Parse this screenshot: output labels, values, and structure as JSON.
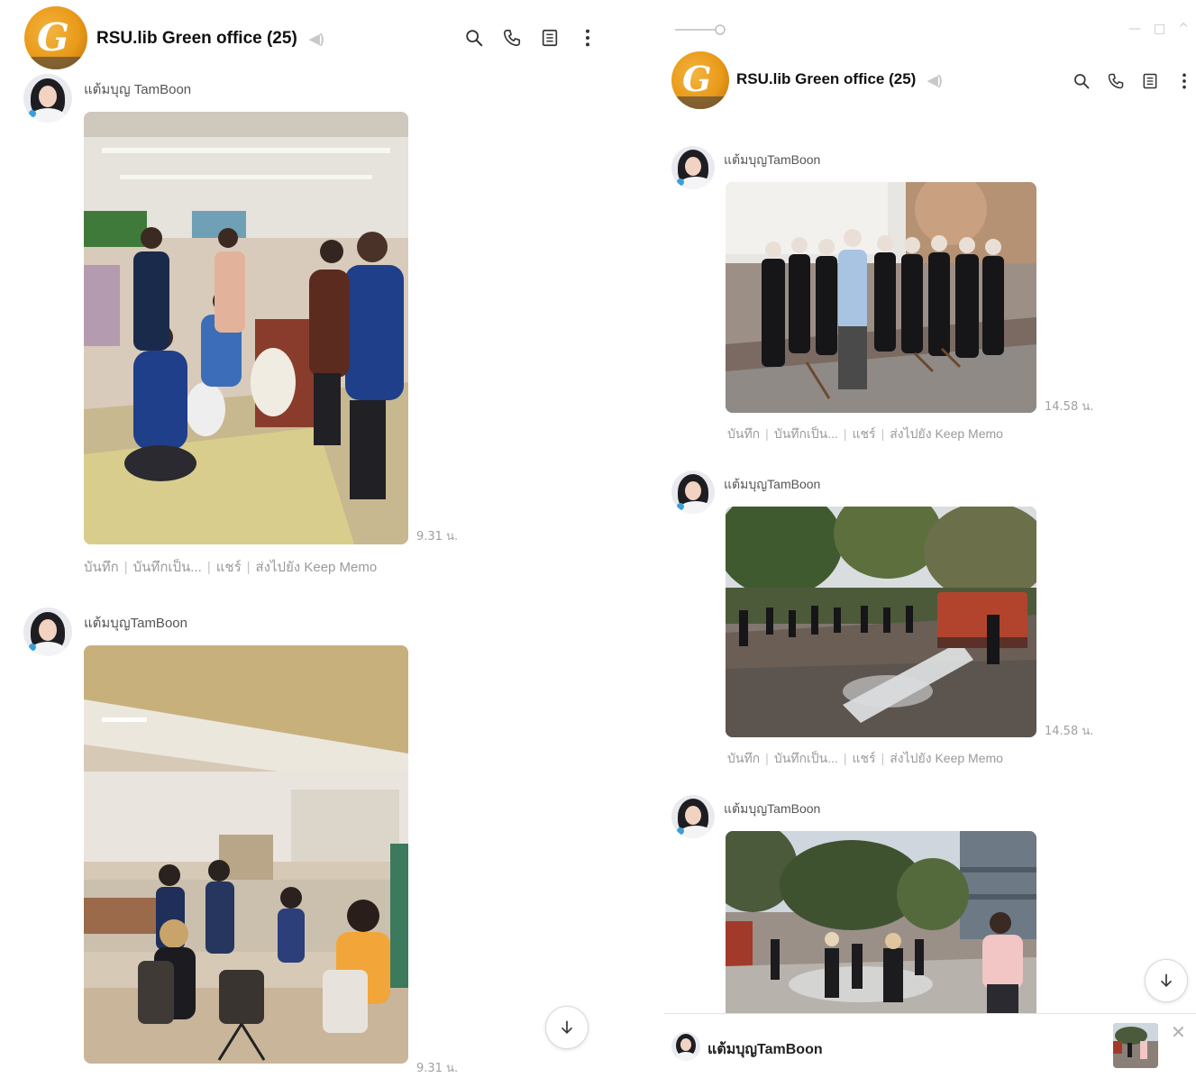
{
  "left_panel": {
    "header": {
      "group_name": "RSU.lib Green office",
      "member_count": "(25)",
      "avatar_letter": "G"
    },
    "messages": [
      {
        "sender": "แต้มบุญ TamBoon",
        "time": "9.31 น.",
        "actions": [
          "บันทึก",
          "บันทึกเป็น...",
          "แชร์",
          "ส่งไปยัง Keep Memo"
        ]
      },
      {
        "sender": "แต้มบุญTamBoon",
        "time": "9.31 น."
      }
    ]
  },
  "right_panel": {
    "header": {
      "group_name": "RSU.lib Green office",
      "member_count": "(25)",
      "avatar_letter": "G"
    },
    "messages": [
      {
        "sender": "แต้มบุญTamBoon",
        "time": "14.58 น.",
        "actions": [
          "บันทึก",
          "บันทึกเป็น...",
          "แชร์",
          "ส่งไปยัง Keep Memo"
        ]
      },
      {
        "sender": "แต้มบุญTamBoon",
        "time": "14.58 น.",
        "actions": [
          "บันทึก",
          "บันทึกเป็น...",
          "แชร์",
          "ส่งไปยัง Keep Memo"
        ]
      },
      {
        "sender": "แต้มบุญTamBoon"
      }
    ],
    "notification": {
      "sender": "แต้มบุญTamBoon"
    }
  },
  "icons": [
    "search-icon",
    "phone-icon",
    "notes-icon",
    "more-icon",
    "mute-icon",
    "arrow-down-icon",
    "close-icon"
  ],
  "colors": {
    "accent_orange": "#e99a18",
    "muted_text": "#9a9a9a",
    "time_text": "#a0a0a0"
  }
}
